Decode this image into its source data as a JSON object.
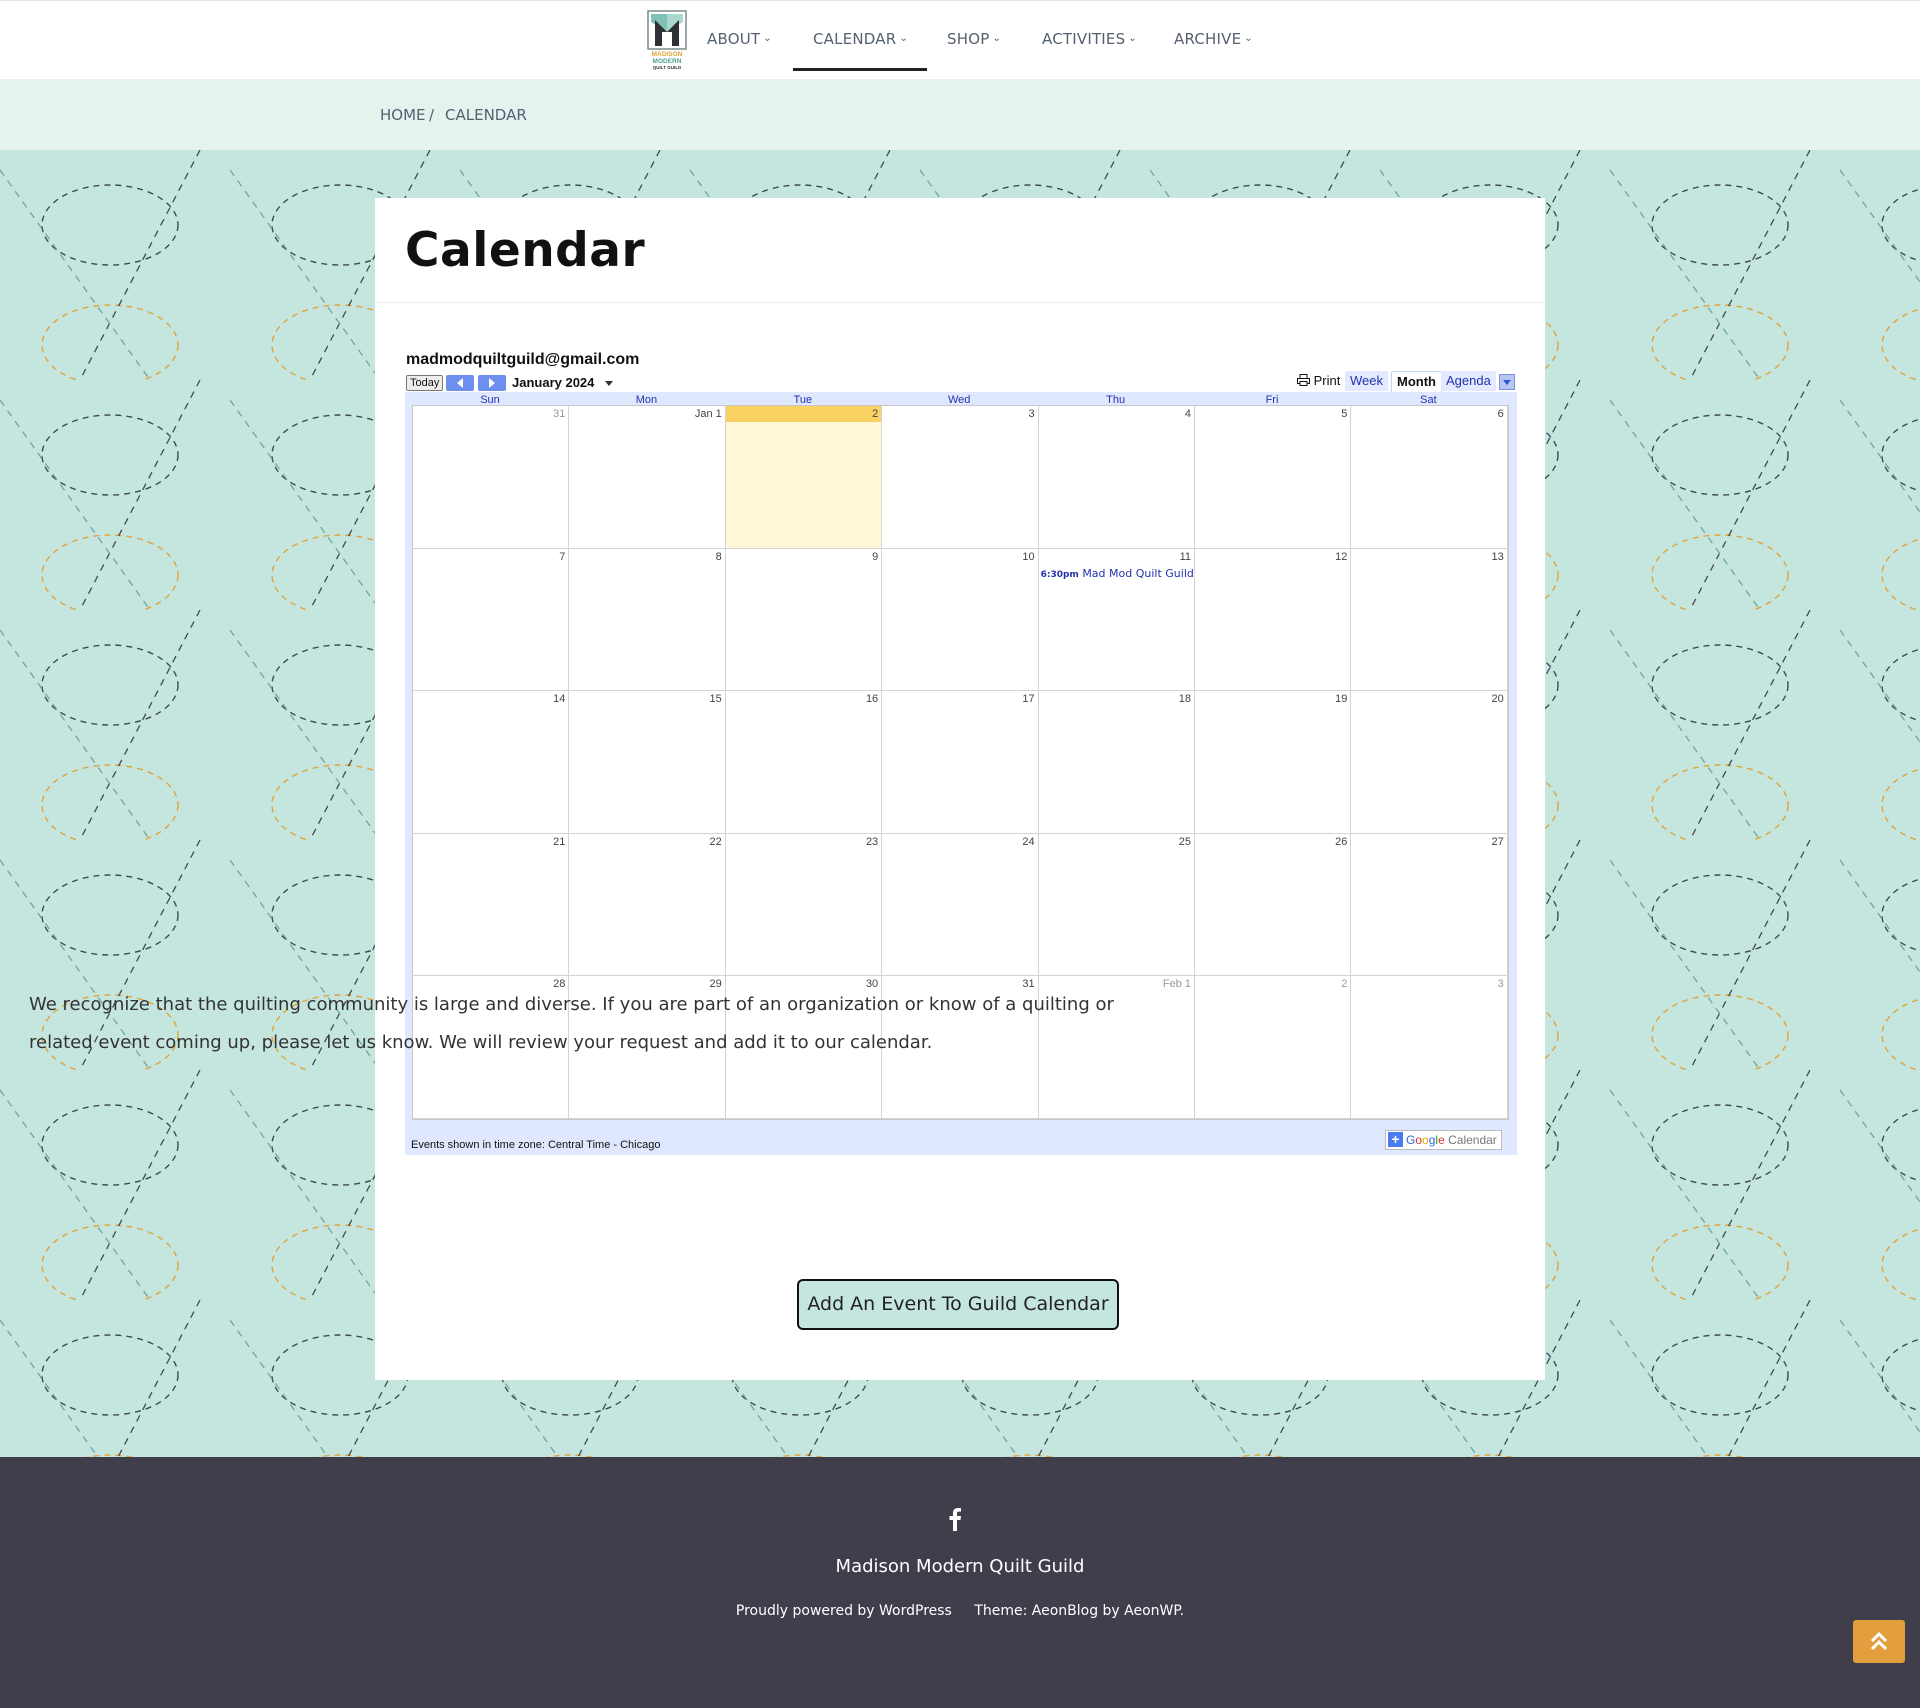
{
  "nav": {
    "logo_text": "MADISON MODERN QUILT GUILD",
    "items": [
      {
        "label": "ABOUT"
      },
      {
        "label": "CALENDAR"
      },
      {
        "label": "SHOP"
      },
      {
        "label": "ACTIVITIES"
      },
      {
        "label": "ARCHIVE"
      }
    ],
    "active": "CALENDAR"
  },
  "breadcrumb": {
    "home": "HOME",
    "separator": "/",
    "current": "CALENDAR"
  },
  "page": {
    "title": "Calendar",
    "paragraph": "We recognize that the quilting community is large and diverse. If you are part of an organization or know of a quilting or related event coming up, please let us know. We will review your request and add it to our calendar.",
    "button_label": "Add An Event To Guild Calendar"
  },
  "calendar": {
    "account": "madmodquiltguild@gmail.com",
    "today_label": "Today",
    "month_label": "January 2024",
    "print_label": "Print",
    "tabs": {
      "week": "Week",
      "month": "Month",
      "agenda": "Agenda"
    },
    "days_of_week": [
      "Sun",
      "Mon",
      "Tue",
      "Wed",
      "Thu",
      "Fri",
      "Sat"
    ],
    "weeks": [
      [
        "31",
        "Jan 1",
        "2",
        "3",
        "4",
        "5",
        "6"
      ],
      [
        "7",
        "8",
        "9",
        "10",
        "11",
        "12",
        "13"
      ],
      [
        "14",
        "15",
        "16",
        "17",
        "18",
        "19",
        "20"
      ],
      [
        "21",
        "22",
        "23",
        "24",
        "25",
        "26",
        "27"
      ],
      [
        "28",
        "29",
        "30",
        "31",
        "Feb 1",
        "2",
        "3"
      ]
    ],
    "event": {
      "time": "6:30pm",
      "title": "Mad Mod Quilt Guild"
    },
    "timezone_note": "Events shown in time zone: Central Time - Chicago",
    "badge": {
      "google": "Google",
      "calendar": "Calendar"
    }
  },
  "footer": {
    "site_name": "Madison Modern Quilt Guild",
    "powered": "Proudly powered by WordPress",
    "theme": "Theme: AeonBlog by AeonWP."
  },
  "colors": {
    "accent": "#c5e6df",
    "footer_bg": "#403e4b",
    "today_highlight": "#fad163",
    "back_to_top": "#e39f3d"
  }
}
